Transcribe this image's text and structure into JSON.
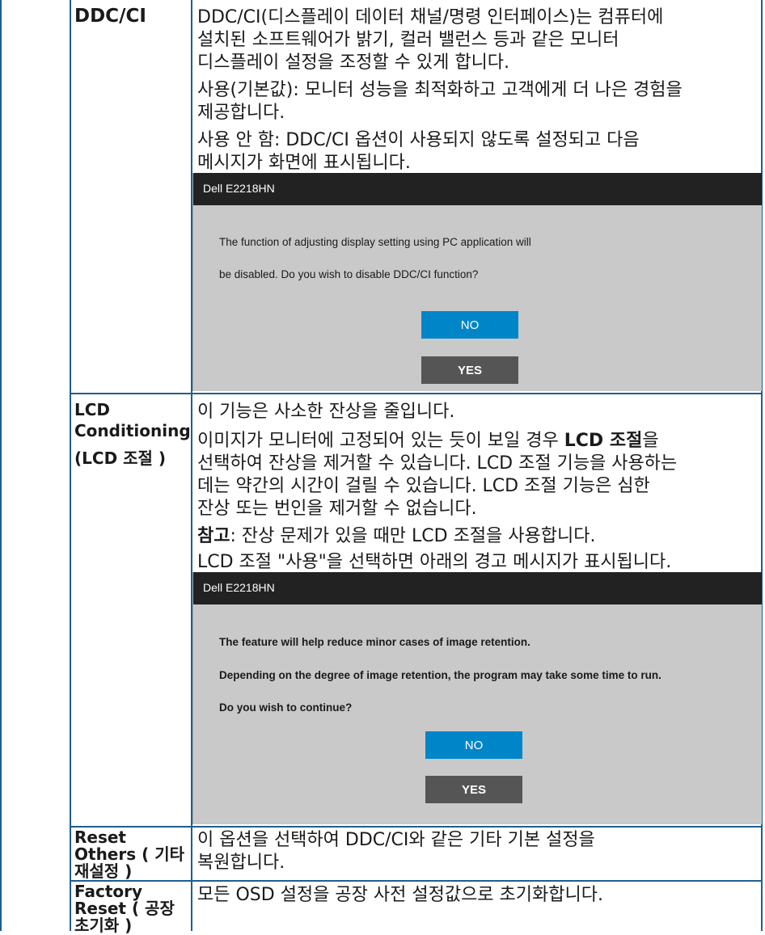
{
  "rows": {
    "ddc": {
      "label": "DDC/CI",
      "p1a": "DDC/CI(디스플레이 데이터 채널/명령 인터페이스)는 컴퓨터에",
      "p1b": "설치된 소프트웨어가 밝기, 컬러 밸런스 등과 같은 모니터",
      "p1c": "디스플레이 설정을 조정할 수 있게 합니다.",
      "p2a": "사용(기본값): 모니터 성능을 최적화하고 고객에게 더 나은 경험을",
      "p2b": "제공합니다.",
      "p3a": "사용 안 함: DDC/CI 옵션이 사용되지 않도록 설정되고 다음",
      "p3b": "메시지가 화면에 표시됩니다.",
      "dialog": {
        "title": "Dell  E2218HN",
        "line1": "The function of adjusting display setting using PC application will",
        "line2": "be disabled. Do you wish to disable DDC/CI function?",
        "no": "NO",
        "yes": "YES"
      }
    },
    "lcd": {
      "label1": "LCD",
      "label2": "Conditioning",
      "label3": "(LCD 조절 )",
      "p1": "이 기능은 사소한 잔상을 줄입니다.",
      "p2a_pre": "이미지가 모니터에 고정되어 있는 듯이 보일 경우 ",
      "p2a_bold": "LCD 조절",
      "p2a_post": "을",
      "p2b": "선택하여 잔상을 제거할 수 있습니다. LCD 조절 기능을 사용하는",
      "p2c": "데는 약간의 시간이 걸릴 수 있습니다. LCD 조절 기능은 심한",
      "p2d": "잔상 또는 번인을 제거할 수 없습니다.",
      "note_bold": "참고",
      "note_rest": ": 잔상 문제가 있을 때만 LCD 조절을 사용합니다.",
      "p4": "LCD 조절 \"사용\"을 선택하면 아래의 경고 메시지가 표시됩니다.",
      "dialog": {
        "title": "Dell  E2218HN",
        "line1": "The feature will help reduce minor cases of image retention.",
        "line2": "Depending on the degree of image retention, the program may take some time to run.",
        "line3": "Do you wish to continue?",
        "no": "NO",
        "yes": "YES"
      }
    },
    "reset_others": {
      "label1": "Reset",
      "label2": "Others ( 기타",
      "label3": "재설정 )",
      "p1a": "이 옵션을 선택하여 DDC/CI와 같은 기타 기본 설정을",
      "p1b": "복원합니다."
    },
    "factory": {
      "label1": "Factory",
      "label2": "Reset ( 공장",
      "label3": "초기화 )",
      "p1": "모든 OSD 설정을 공장 사전 설정값으로 초기화합니다."
    }
  }
}
